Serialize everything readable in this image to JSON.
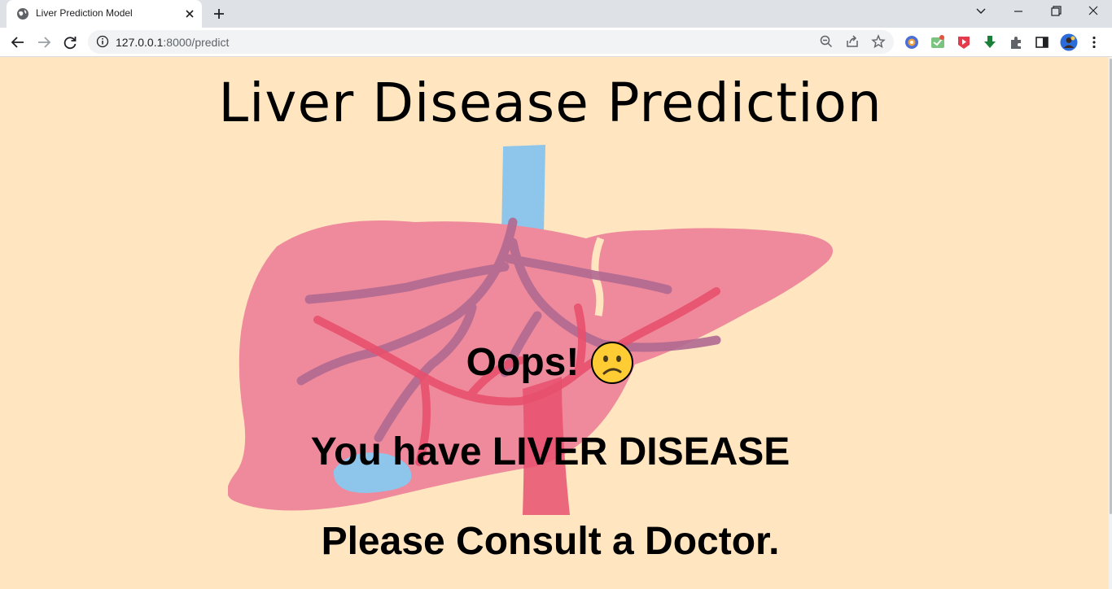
{
  "browser": {
    "tab_title": "Liver Prediction Model",
    "url_host": "127.0.0.1",
    "url_path": ":8000/predict"
  },
  "page": {
    "heading": "Liver Disease Prediction",
    "oops": "Oops!",
    "diagnosis": "You have LIVER DISEASE",
    "advice": "Please Consult a Doctor."
  },
  "colors": {
    "page_background": "#ffe6c0",
    "liver_pink": "#ef8a9c",
    "vessel_blue": "#8ec5ea",
    "artery_red": "#e8506e",
    "vein_purple": "#b06891",
    "emoji_yellow": "#ffcc33"
  }
}
